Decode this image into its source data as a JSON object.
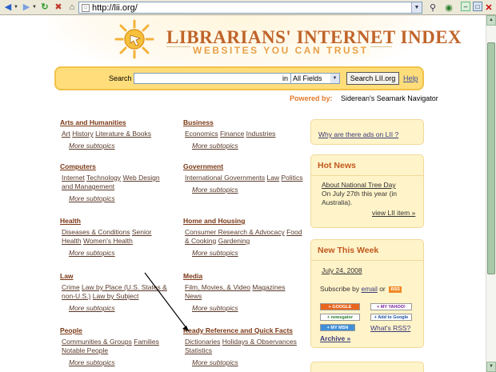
{
  "browser": {
    "url": "http://lii.org/",
    "icons": [
      "back-arrow-icon",
      "forward-arrow-icon",
      "refresh-icon",
      "stop-icon",
      "home-icon",
      "favicon-icon",
      "go-icon",
      "search-icon",
      "globe-icon",
      "minimize-icon",
      "maximize-icon",
      "close-icon"
    ]
  },
  "header": {
    "title": "LIBRARIANS' INTERNET INDEX",
    "subtitle": "WEBSITES YOU CAN TRUST"
  },
  "search": {
    "label": "Search",
    "value": "",
    "in_label": "in",
    "scope": "All Fields",
    "button": "Search LII.org",
    "help": "Help"
  },
  "powered": {
    "label": "Powered by:",
    "text": "Siderean's Seamark Navigator"
  },
  "more_label": "More subtopics",
  "categories": [
    {
      "title": "Arts and Humanities",
      "links": [
        "Art",
        "History",
        "Literature & Books"
      ]
    },
    {
      "title": "Business",
      "links": [
        "Economics",
        "Finance",
        "Industries"
      ]
    },
    {
      "title": "Computers",
      "links": [
        "Internet",
        "Technology",
        "Web Design and Management"
      ]
    },
    {
      "title": "Government",
      "links": [
        "International Governments",
        "Law",
        "Politics"
      ]
    },
    {
      "title": "Health",
      "links": [
        "Diseases & Conditions",
        "Senior Health",
        "Women's Health"
      ]
    },
    {
      "title": "Home and Housing",
      "links": [
        "Consumer Research & Advocacy",
        "Food & Cooking",
        "Gardening"
      ]
    },
    {
      "title": "Law",
      "links": [
        "Crime",
        "Law by Place (U.S. States & non-U.S.)",
        "Law by Subject"
      ]
    },
    {
      "title": "Media",
      "links": [
        "Film, Movies, & Video",
        "Magazines",
        "News"
      ]
    },
    {
      "title": "People",
      "links": [
        "Communities & Groups",
        "Families",
        "Notable People"
      ]
    },
    {
      "title": "Ready Reference and Quick Facts",
      "links": [
        "Dictionaries",
        "Holidays & Observances",
        "Statistics"
      ]
    }
  ],
  "sidebar": {
    "ads_link": "Why are there ads on LII ?",
    "hot_news": {
      "title": "Hot News",
      "link": "About National Tree Day",
      "text": "On July 27th this year (in Australia).",
      "more": "view LII item »"
    },
    "new_this_week": {
      "title": "New This Week",
      "date": "July 24, 2008",
      "subscribe": "Subscribe by",
      "email": "email",
      "or": "or",
      "rss": "RSS",
      "badges": [
        "+ GOOGLE",
        "+ MY YAHOO!",
        "+ newsgator",
        "+ Add to Google",
        "+ MY MSN"
      ],
      "whats_rss": "What's RSS?",
      "archive": "Archive »"
    }
  }
}
